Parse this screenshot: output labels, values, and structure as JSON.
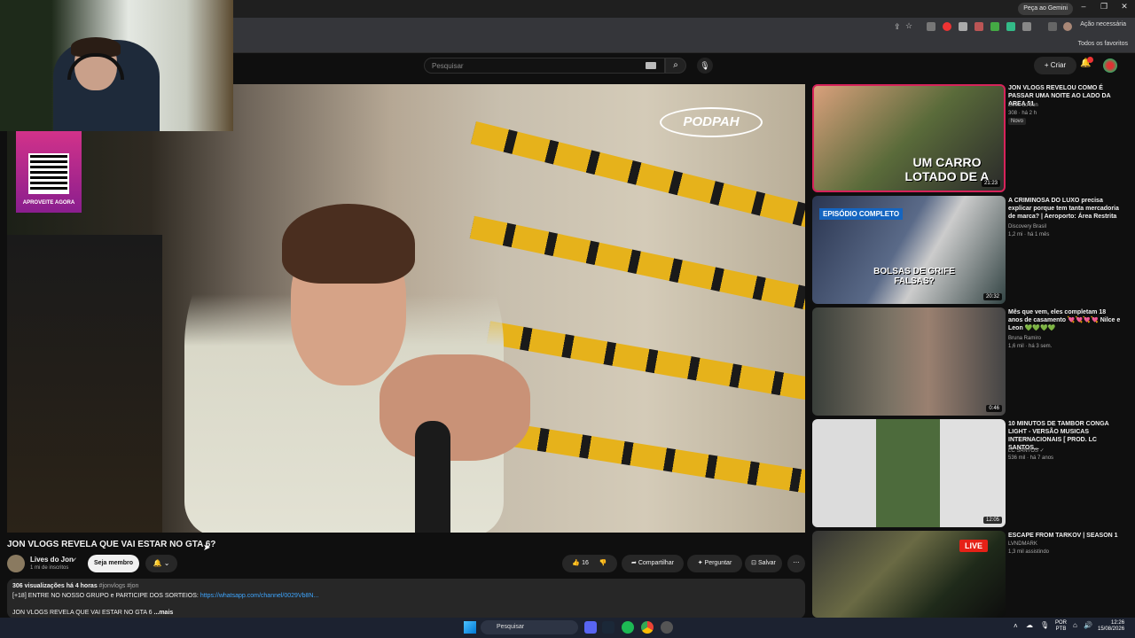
{
  "browser": {
    "gemini_label": "Peça ao Gemini",
    "action_label": "Ação necessária",
    "bookmarks_label": "Todos os favoritos"
  },
  "youtube": {
    "search_placeholder": "Pesquisar",
    "create_label": "+ Criar"
  },
  "overlay": {
    "qr_caption": "APROVEITE AGORA",
    "channel_logo": "PODPAH"
  },
  "video": {
    "title": "JON VLOGS REVELA QUE VAI ESTAR NO GTA 6?",
    "channel": "Lives do Jon",
    "subscribers": "1 mi de inscritos",
    "member_label": "Seja membro",
    "likes": "16",
    "share_label": "Compartilhar",
    "ask_label": "Perguntar",
    "save_label": "Salvar"
  },
  "description": {
    "stats": "306 visualizações  há 4 horas",
    "tags": " #jonvlogs #jon",
    "line2_text": "[+18] ENTRE NO NOSSO GRUPO e PARTICIPE DOS SORTEIOS: ",
    "line2_link": "https://whatsapp.com/channel/0029Vb8N...",
    "line3": "JON VLOGS REVELA QUE VAI ESTAR NO GTA 6 ",
    "more": "...mais"
  },
  "recommendations": [
    {
      "title": "JON VLOGS REVELOU COMO É PASSAR UMA NOITE AO LADO DA AREA 51",
      "channel": "Lives do Jon",
      "meta": "308 · há 2 h",
      "badge": "Novo",
      "duration": "21:23",
      "thumb_text": "UM CARRO LOTADO DE A"
    },
    {
      "title": "A CRIMINOSA DO LUXO precisa explicar porque tem tanta mercadoria de marca? | Aeroporto: Área Restrita",
      "channel": "Discovery Brasil",
      "meta": "1,2 mi · há 1 mês",
      "duration": "20:32",
      "thumb_text": "BOLSAS DE GRIFE FALSAS?",
      "thumb_tag": "EPISÓDIO COMPLETO"
    },
    {
      "title": "Mês que vem, eles completam 18 anos de casamento 💘💘💘💘 Nilce e Leon 💚💚💚💚",
      "channel": "Bruna Ramiro",
      "meta": "1,6 mil · há 3 sem.",
      "duration": "0:46"
    },
    {
      "title": "10 MINUTOS DE TAMBOR CONGA LIGHT - VERSÃO MUSICAS INTERNACIONAIS [ PROD. LC SANTOS...",
      "channel": "LC SANTOS ✓",
      "meta": "536 mil · há 7 anos",
      "duration": "12:05"
    },
    {
      "title": "ESCAPE FROM TARKOV | SEASON 1",
      "channel": "LVNDMARK",
      "meta": "1,3 mil assistindo",
      "live": "LIVE"
    }
  ],
  "taskbar": {
    "search_label": "Pesquisar",
    "lang1": "POR",
    "lang2": "PTB",
    "time": "12:26",
    "date": "15/08/2026"
  },
  "colors": {
    "accent_red": "#ff0000",
    "link_blue": "#3ea6ff",
    "background": "#0f0f0f"
  }
}
